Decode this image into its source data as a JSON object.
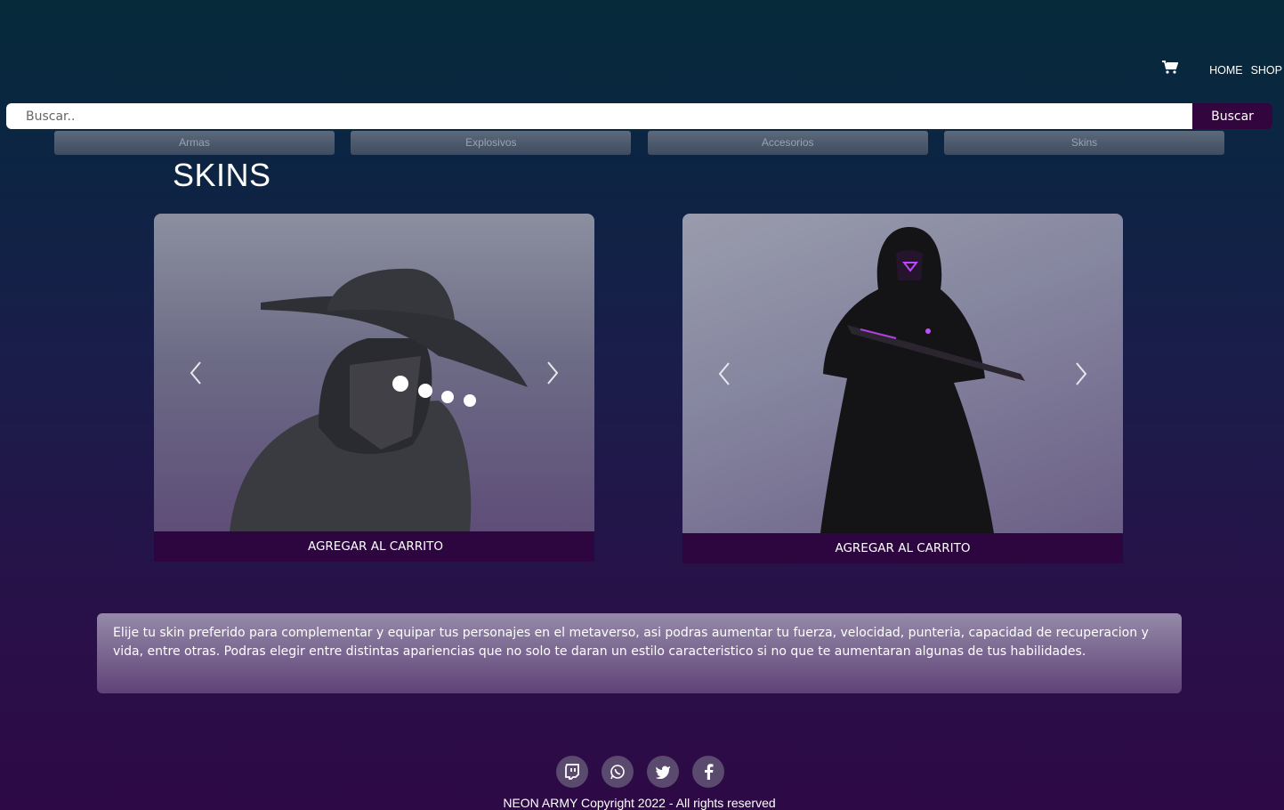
{
  "nav": {
    "home": "HOME",
    "shop": "SHOP",
    "cart_icon": "cart-icon"
  },
  "search": {
    "placeholder": "Buscar..",
    "value": "",
    "button": "Buscar"
  },
  "categories": [
    "Armas",
    "Explosivos",
    "Accesorios",
    "Skins"
  ],
  "page_title": "SKINS",
  "cards": [
    {
      "button": "AGREGAR AL CARRITO"
    },
    {
      "button": "AGREGAR AL CARRITO"
    }
  ],
  "description": "Elije tu skin preferido para complementar y equipar tus personajes en el metaverso, asi podras aumentar tu fuerza, velocidad, punteria, capacidad de recuperacion y vida, entre otras. Podras elegir entre distintas apariencias que no solo te daran un estilo caracteristico si no que te aumentaran algunas de tus habilidades.",
  "social": [
    "twitch-icon",
    "whatsapp-icon",
    "twitter-icon",
    "facebook-icon"
  ],
  "footer": "NEON ARMY Copyright 2022 - All rights reserved",
  "colors": {
    "accent": "#33053f",
    "card_button": "#2d0640",
    "social_bg": "#5a4a6e"
  }
}
